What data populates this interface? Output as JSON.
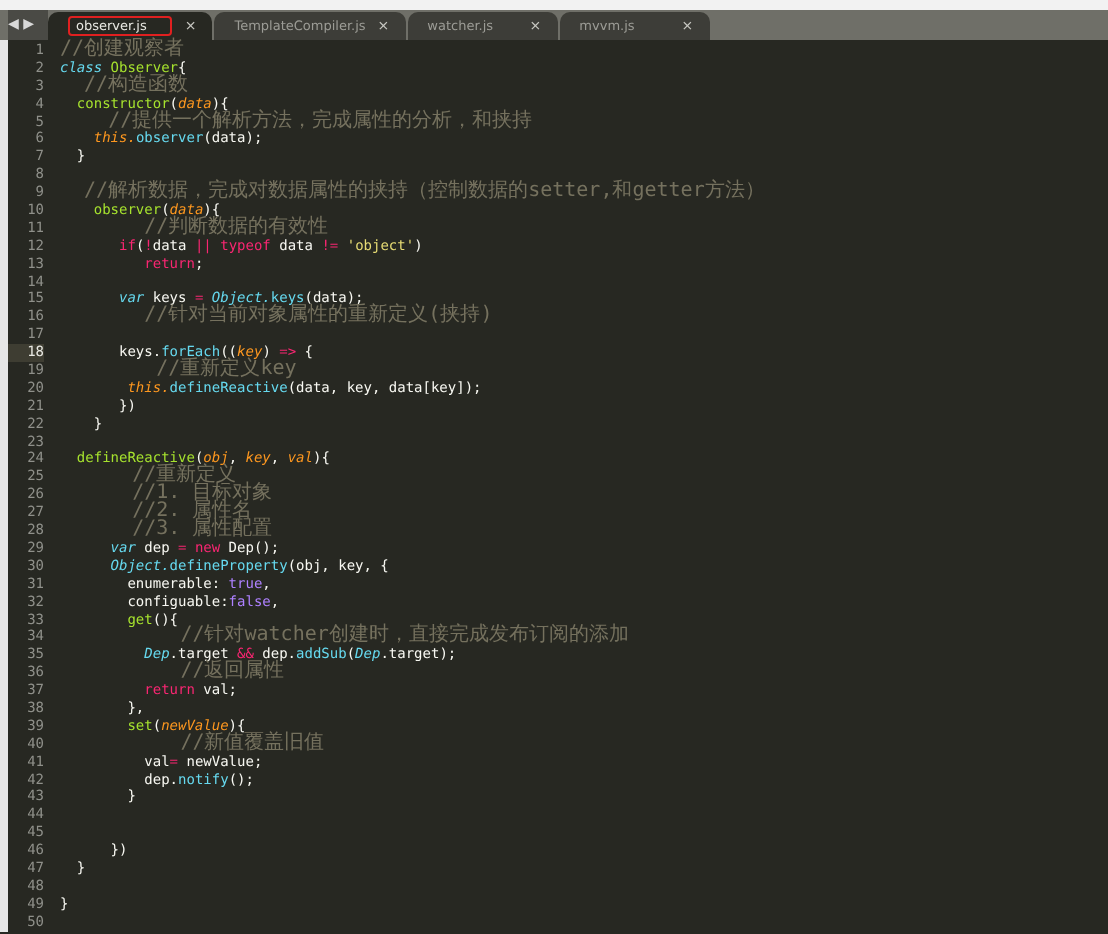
{
  "tabs": [
    {
      "label": "observer.js",
      "selected": true,
      "annotated": true,
      "close": "×"
    },
    {
      "label": "TemplateCompiler.js",
      "selected": false,
      "annotated": false,
      "close": "×"
    },
    {
      "label": "watcher.js",
      "selected": false,
      "annotated": false,
      "close": "×"
    },
    {
      "label": "mvvm.js",
      "selected": false,
      "annotated": false,
      "close": "×"
    }
  ],
  "nav": "◀ ▶",
  "lines": [
    {
      "n": "1",
      "current": false,
      "tokens": [
        {
          "kind": "comment",
          "text": "//创建观察者"
        }
      ]
    },
    {
      "n": "2",
      "current": false,
      "tokens": [
        {
          "kind": "storage",
          "text": "class"
        },
        {
          "kind": "class",
          "text": " Observer"
        },
        {
          "kind": "plain",
          "text": "{"
        }
      ]
    },
    {
      "n": "3",
      "current": false,
      "tokens": [
        {
          "kind": "comment",
          "text": "  //构造函数"
        }
      ]
    },
    {
      "n": "4",
      "current": false,
      "tokens": [
        {
          "kind": "function",
          "text": "  constructor"
        },
        {
          "kind": "plain",
          "text": "("
        },
        {
          "kind": "parameter",
          "text": "data"
        },
        {
          "kind": "plain",
          "text": "){"
        }
      ]
    },
    {
      "n": "5",
      "current": false,
      "tokens": [
        {
          "kind": "comment",
          "text": "    //提供一个解析方法，完成属性的分析，和挟持"
        }
      ]
    },
    {
      "n": "6",
      "current": false,
      "tokens": [
        {
          "kind": "language",
          "text": "    this."
        },
        {
          "kind": "support",
          "text": "observer"
        },
        {
          "kind": "plain",
          "text": "(data);"
        }
      ]
    },
    {
      "n": "7",
      "current": false,
      "tokens": [
        {
          "kind": "plain",
          "text": "  }"
        }
      ]
    },
    {
      "n": "8",
      "current": false
    },
    {
      "n": "9",
      "current": false,
      "tokens": [
        {
          "kind": "comment",
          "text": "  //解析数据，完成对数据属性的挟持（控制数据的setter,和getter方法）"
        }
      ]
    },
    {
      "n": "10",
      "current": false,
      "tokens": [
        {
          "kind": "function",
          "text": "    observer"
        },
        {
          "kind": "plain",
          "text": "("
        },
        {
          "kind": "parameter",
          "text": "data"
        },
        {
          "kind": "plain",
          "text": "){"
        }
      ]
    },
    {
      "n": "11",
      "current": false,
      "tokens": [
        {
          "kind": "comment",
          "text": "       //判断数据的有效性"
        }
      ]
    },
    {
      "n": "12",
      "current": false,
      "tokens": [
        {
          "kind": "keyword",
          "text": "       if"
        },
        {
          "kind": "plain",
          "text": "("
        },
        {
          "kind": "keyword",
          "text": "!"
        },
        {
          "kind": "plain",
          "text": "data "
        },
        {
          "kind": "keyword",
          "text": "||"
        },
        {
          "kind": "keyword",
          "text": " typeof"
        },
        {
          "kind": "plain",
          "text": " data "
        },
        {
          "kind": "keyword",
          "text": "!="
        },
        {
          "kind": "string",
          "text": " 'object'"
        },
        {
          "kind": "plain",
          "text": ")"
        }
      ]
    },
    {
      "n": "13",
      "current": false,
      "tokens": [
        {
          "kind": "keyword",
          "text": "          return"
        },
        {
          "kind": "plain",
          "text": ";"
        }
      ]
    },
    {
      "n": "14",
      "current": false
    },
    {
      "n": "15",
      "current": false,
      "tokens": [
        {
          "kind": "storage",
          "text": "       var"
        },
        {
          "kind": "plain",
          "text": " keys "
        },
        {
          "kind": "keyword",
          "text": "="
        },
        {
          "kind": "type",
          "text": " Object."
        },
        {
          "kind": "support",
          "text": "keys"
        },
        {
          "kind": "plain",
          "text": "(data);"
        }
      ]
    },
    {
      "n": "16",
      "current": false,
      "tokens": [
        {
          "kind": "comment",
          "text": "       //针对当前对象属性的重新定义(挟持)"
        }
      ]
    },
    {
      "n": "17",
      "current": false
    },
    {
      "n": "18",
      "current": true,
      "tokens": [
        {
          "kind": "plain",
          "text": "       keys."
        },
        {
          "kind": "support",
          "text": "forEach"
        },
        {
          "kind": "plain",
          "text": "(("
        },
        {
          "kind": "parameter",
          "text": "key"
        },
        {
          "kind": "plain",
          "text": ") "
        },
        {
          "kind": "keyword",
          "text": "=>"
        },
        {
          "kind": "plain",
          "text": " {"
        }
      ]
    },
    {
      "n": "19",
      "current": false,
      "tokens": [
        {
          "kind": "comment",
          "text": "        //重新定义key"
        }
      ]
    },
    {
      "n": "20",
      "current": false,
      "tokens": [
        {
          "kind": "language",
          "text": "        this."
        },
        {
          "kind": "support",
          "text": "defineReactive"
        },
        {
          "kind": "plain",
          "text": "(data, key, data[key]);"
        }
      ]
    },
    {
      "n": "21",
      "current": false,
      "tokens": [
        {
          "kind": "plain",
          "text": "       })"
        }
      ]
    },
    {
      "n": "22",
      "current": false,
      "tokens": [
        {
          "kind": "plain",
          "text": "    }"
        }
      ]
    },
    {
      "n": "23",
      "current": false
    },
    {
      "n": "24",
      "current": false,
      "tokens": [
        {
          "kind": "function",
          "text": "  defineReactive"
        },
        {
          "kind": "plain",
          "text": "("
        },
        {
          "kind": "parameter",
          "text": "obj"
        },
        {
          "kind": "plain",
          "text": ", "
        },
        {
          "kind": "parameter",
          "text": "key"
        },
        {
          "kind": "plain",
          "text": ", "
        },
        {
          "kind": "parameter",
          "text": "val"
        },
        {
          "kind": "plain",
          "text": "){"
        }
      ]
    },
    {
      "n": "25",
      "current": false,
      "tokens": [
        {
          "kind": "comment",
          "text": "      //重新定义"
        }
      ]
    },
    {
      "n": "26",
      "current": false,
      "tokens": [
        {
          "kind": "comment",
          "text": "      //1. 目标对象"
        }
      ]
    },
    {
      "n": "27",
      "current": false,
      "tokens": [
        {
          "kind": "comment",
          "text": "      //2. 属性名"
        }
      ]
    },
    {
      "n": "28",
      "current": false,
      "tokens": [
        {
          "kind": "comment",
          "text": "      //3. 属性配置"
        }
      ]
    },
    {
      "n": "29",
      "current": false,
      "tokens": [
        {
          "kind": "storage",
          "text": "      var"
        },
        {
          "kind": "plain",
          "text": " dep "
        },
        {
          "kind": "keyword",
          "text": "="
        },
        {
          "kind": "keyword",
          "text": " new"
        },
        {
          "kind": "plain",
          "text": " Dep();"
        }
      ]
    },
    {
      "n": "30",
      "current": false,
      "tokens": [
        {
          "kind": "type",
          "text": "      Object."
        },
        {
          "kind": "support",
          "text": "defineProperty"
        },
        {
          "kind": "plain",
          "text": "(obj, key, {"
        }
      ]
    },
    {
      "n": "31",
      "current": false,
      "tokens": [
        {
          "kind": "plain",
          "text": "        enumerable: "
        },
        {
          "kind": "constant",
          "text": "true"
        },
        {
          "kind": "plain",
          "text": ","
        }
      ]
    },
    {
      "n": "32",
      "current": false,
      "tokens": [
        {
          "kind": "plain",
          "text": "        configuable:"
        },
        {
          "kind": "constant",
          "text": "false"
        },
        {
          "kind": "plain",
          "text": ","
        }
      ]
    },
    {
      "n": "33",
      "current": false,
      "tokens": [
        {
          "kind": "function",
          "text": "        get"
        },
        {
          "kind": "plain",
          "text": "(){"
        }
      ]
    },
    {
      "n": "34",
      "current": false,
      "tokens": [
        {
          "kind": "comment",
          "text": "          //针对watcher创建时，直接完成发布订阅的添加"
        }
      ]
    },
    {
      "n": "35",
      "current": false,
      "tokens": [
        {
          "kind": "type",
          "text": "          Dep"
        },
        {
          "kind": "plain",
          "text": ".target "
        },
        {
          "kind": "keyword",
          "text": "&&"
        },
        {
          "kind": "plain",
          "text": " dep."
        },
        {
          "kind": "support",
          "text": "addSub"
        },
        {
          "kind": "plain",
          "text": "("
        },
        {
          "kind": "type",
          "text": "Dep"
        },
        {
          "kind": "plain",
          "text": ".target);"
        }
      ]
    },
    {
      "n": "36",
      "current": false,
      "tokens": [
        {
          "kind": "comment",
          "text": "          //返回属性"
        }
      ]
    },
    {
      "n": "37",
      "current": false,
      "tokens": [
        {
          "kind": "keyword",
          "text": "          return"
        },
        {
          "kind": "plain",
          "text": " val;"
        }
      ]
    },
    {
      "n": "38",
      "current": false,
      "tokens": [
        {
          "kind": "plain",
          "text": "        },"
        }
      ]
    },
    {
      "n": "39",
      "current": false,
      "tokens": [
        {
          "kind": "function",
          "text": "        set"
        },
        {
          "kind": "plain",
          "text": "("
        },
        {
          "kind": "parameter",
          "text": "newValue"
        },
        {
          "kind": "plain",
          "text": "){"
        }
      ]
    },
    {
      "n": "40",
      "current": false,
      "tokens": [
        {
          "kind": "comment",
          "text": "          //新值覆盖旧值"
        }
      ]
    },
    {
      "n": "41",
      "current": false,
      "tokens": [
        {
          "kind": "plain",
          "text": "          val"
        },
        {
          "kind": "keyword",
          "text": "="
        },
        {
          "kind": "plain",
          "text": " newValue;"
        }
      ]
    },
    {
      "n": "42",
      "current": false,
      "tokens": [
        {
          "kind": "plain",
          "text": "          dep."
        },
        {
          "kind": "support",
          "text": "notify"
        },
        {
          "kind": "plain",
          "text": "();"
        }
      ]
    },
    {
      "n": "43",
      "current": false,
      "tokens": [
        {
          "kind": "plain",
          "text": "        }"
        }
      ]
    },
    {
      "n": "44",
      "current": false
    },
    {
      "n": "45",
      "current": false
    },
    {
      "n": "46",
      "current": false,
      "tokens": [
        {
          "kind": "plain",
          "text": "      })"
        }
      ]
    },
    {
      "n": "47",
      "current": false,
      "tokens": [
        {
          "kind": "plain",
          "text": "  }"
        }
      ]
    },
    {
      "n": "48",
      "current": false
    },
    {
      "n": "49",
      "current": false,
      "tokens": [
        {
          "kind": "plain",
          "text": "}"
        }
      ]
    },
    {
      "n": "50",
      "current": false
    }
  ]
}
